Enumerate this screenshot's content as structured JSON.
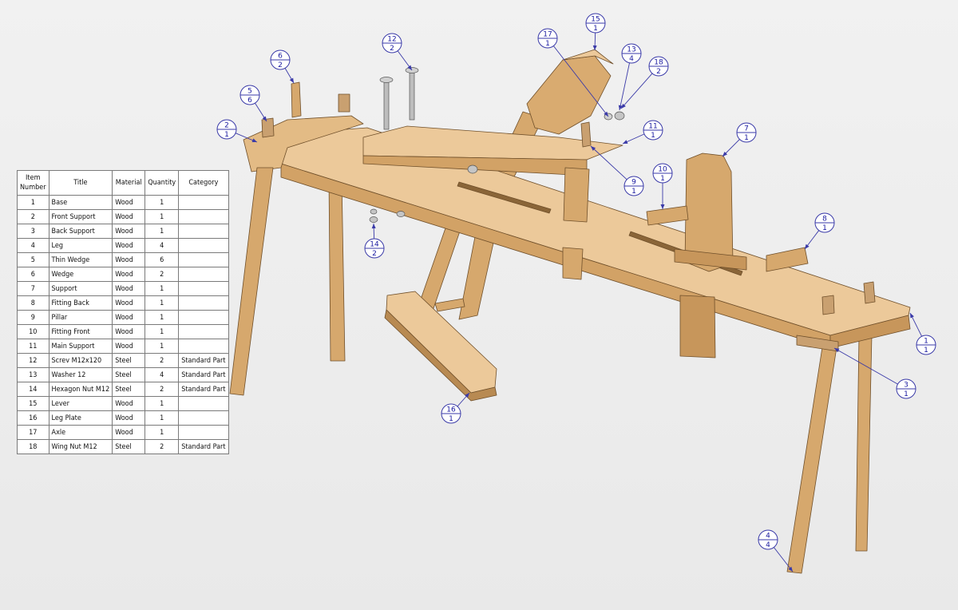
{
  "bom": {
    "headers": [
      "Item\nNumber",
      "Title",
      "Material",
      "Quantity",
      "Category"
    ],
    "rows": [
      [
        "1",
        "Base",
        "Wood",
        "1",
        ""
      ],
      [
        "2",
        "Front Support",
        "Wood",
        "1",
        ""
      ],
      [
        "3",
        "Back Support",
        "Wood",
        "1",
        ""
      ],
      [
        "4",
        "Leg",
        "Wood",
        "4",
        ""
      ],
      [
        "5",
        "Thin Wedge",
        "Wood",
        "6",
        ""
      ],
      [
        "6",
        "Wedge",
        "Wood",
        "2",
        ""
      ],
      [
        "7",
        "Support",
        "Wood",
        "1",
        ""
      ],
      [
        "8",
        "Fitting Back",
        "Wood",
        "1",
        ""
      ],
      [
        "9",
        "Pillar",
        "Wood",
        "1",
        ""
      ],
      [
        "10",
        "Fitting Front",
        "Wood",
        "1",
        ""
      ],
      [
        "11",
        "Main Support",
        "Wood",
        "1",
        ""
      ],
      [
        "12",
        "Screv M12x120",
        "Steel",
        "2",
        "Standard Part"
      ],
      [
        "13",
        "Washer 12",
        "Steel",
        "4",
        "Standard Part"
      ],
      [
        "14",
        "Hexagon Nut M12",
        "Steel",
        "2",
        "Standard Part"
      ],
      [
        "15",
        "Lever",
        "Wood",
        "1",
        ""
      ],
      [
        "16",
        "Leg Plate",
        "Wood",
        "1",
        ""
      ],
      [
        "17",
        "Axle",
        "Wood",
        "1",
        ""
      ],
      [
        "18",
        "Wing Nut M12",
        "Steel",
        "2",
        "Standard Part"
      ]
    ]
  },
  "balloons": [
    {
      "item": "1",
      "qty": "1"
    },
    {
      "item": "2",
      "qty": "1"
    },
    {
      "item": "3",
      "qty": "1"
    },
    {
      "item": "4",
      "qty": "4"
    },
    {
      "item": "5",
      "qty": "6"
    },
    {
      "item": "6",
      "qty": "2"
    },
    {
      "item": "7",
      "qty": "1"
    },
    {
      "item": "8",
      "qty": "1"
    },
    {
      "item": "9",
      "qty": "1"
    },
    {
      "item": "10",
      "qty": "1"
    },
    {
      "item": "11",
      "qty": "1"
    },
    {
      "item": "12",
      "qty": "2"
    },
    {
      "item": "13",
      "qty": "4"
    },
    {
      "item": "14",
      "qty": "2"
    },
    {
      "item": "15",
      "qty": "1"
    },
    {
      "item": "16",
      "qty": "1"
    },
    {
      "item": "17",
      "qty": "1"
    },
    {
      "item": "18",
      "qty": "2"
    }
  ],
  "colors": {
    "wood_top": "#ecc99a",
    "wood_side": "#d6a86d",
    "wood_dark": "#b88a52",
    "steel": "#b9b9b9",
    "balloon": "#1a1aa0"
  }
}
